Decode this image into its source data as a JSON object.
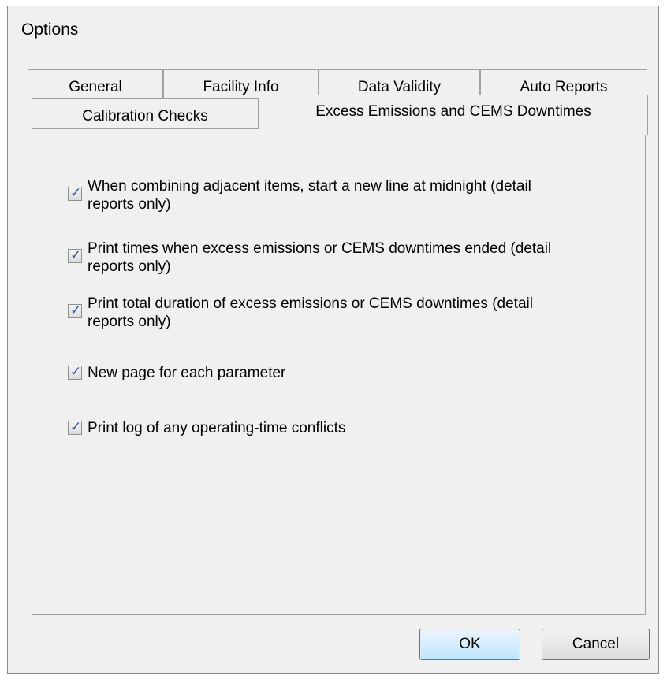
{
  "window": {
    "title": "Options"
  },
  "tabs_back_row": [
    {
      "label": "General"
    },
    {
      "label": "Facility Info"
    },
    {
      "label": "Data Validity"
    },
    {
      "label": "Auto Reports"
    }
  ],
  "tabs_front_row": [
    {
      "label": "Calibration Checks"
    },
    {
      "label": "Excess Emissions and CEMS Downtimes",
      "active": true
    }
  ],
  "options": [
    {
      "label_line1": "When combining adjacent items, start a new line at midnight (detail",
      "label_line2": "reports only)",
      "checked": true
    },
    {
      "label_line1": "Print times when excess emissions or CEMS downtimes ended (detail",
      "label_line2": "reports only)",
      "checked": true
    },
    {
      "label_line1": "Print total duration of excess emissions or CEMS downtimes (detail",
      "label_line2": "reports only)",
      "checked": true
    },
    {
      "label_line1": "New page for each parameter",
      "label_line2": "",
      "checked": true
    },
    {
      "label_line1": "Print log of any operating-time conflicts",
      "label_line2": "",
      "checked": true
    }
  ],
  "buttons": {
    "ok": "OK",
    "cancel": "Cancel"
  },
  "colors": {
    "dialog_bg": "#f0f0f0",
    "ok_border": "#3c7fb1",
    "check_mark": "#2b4fa8"
  }
}
